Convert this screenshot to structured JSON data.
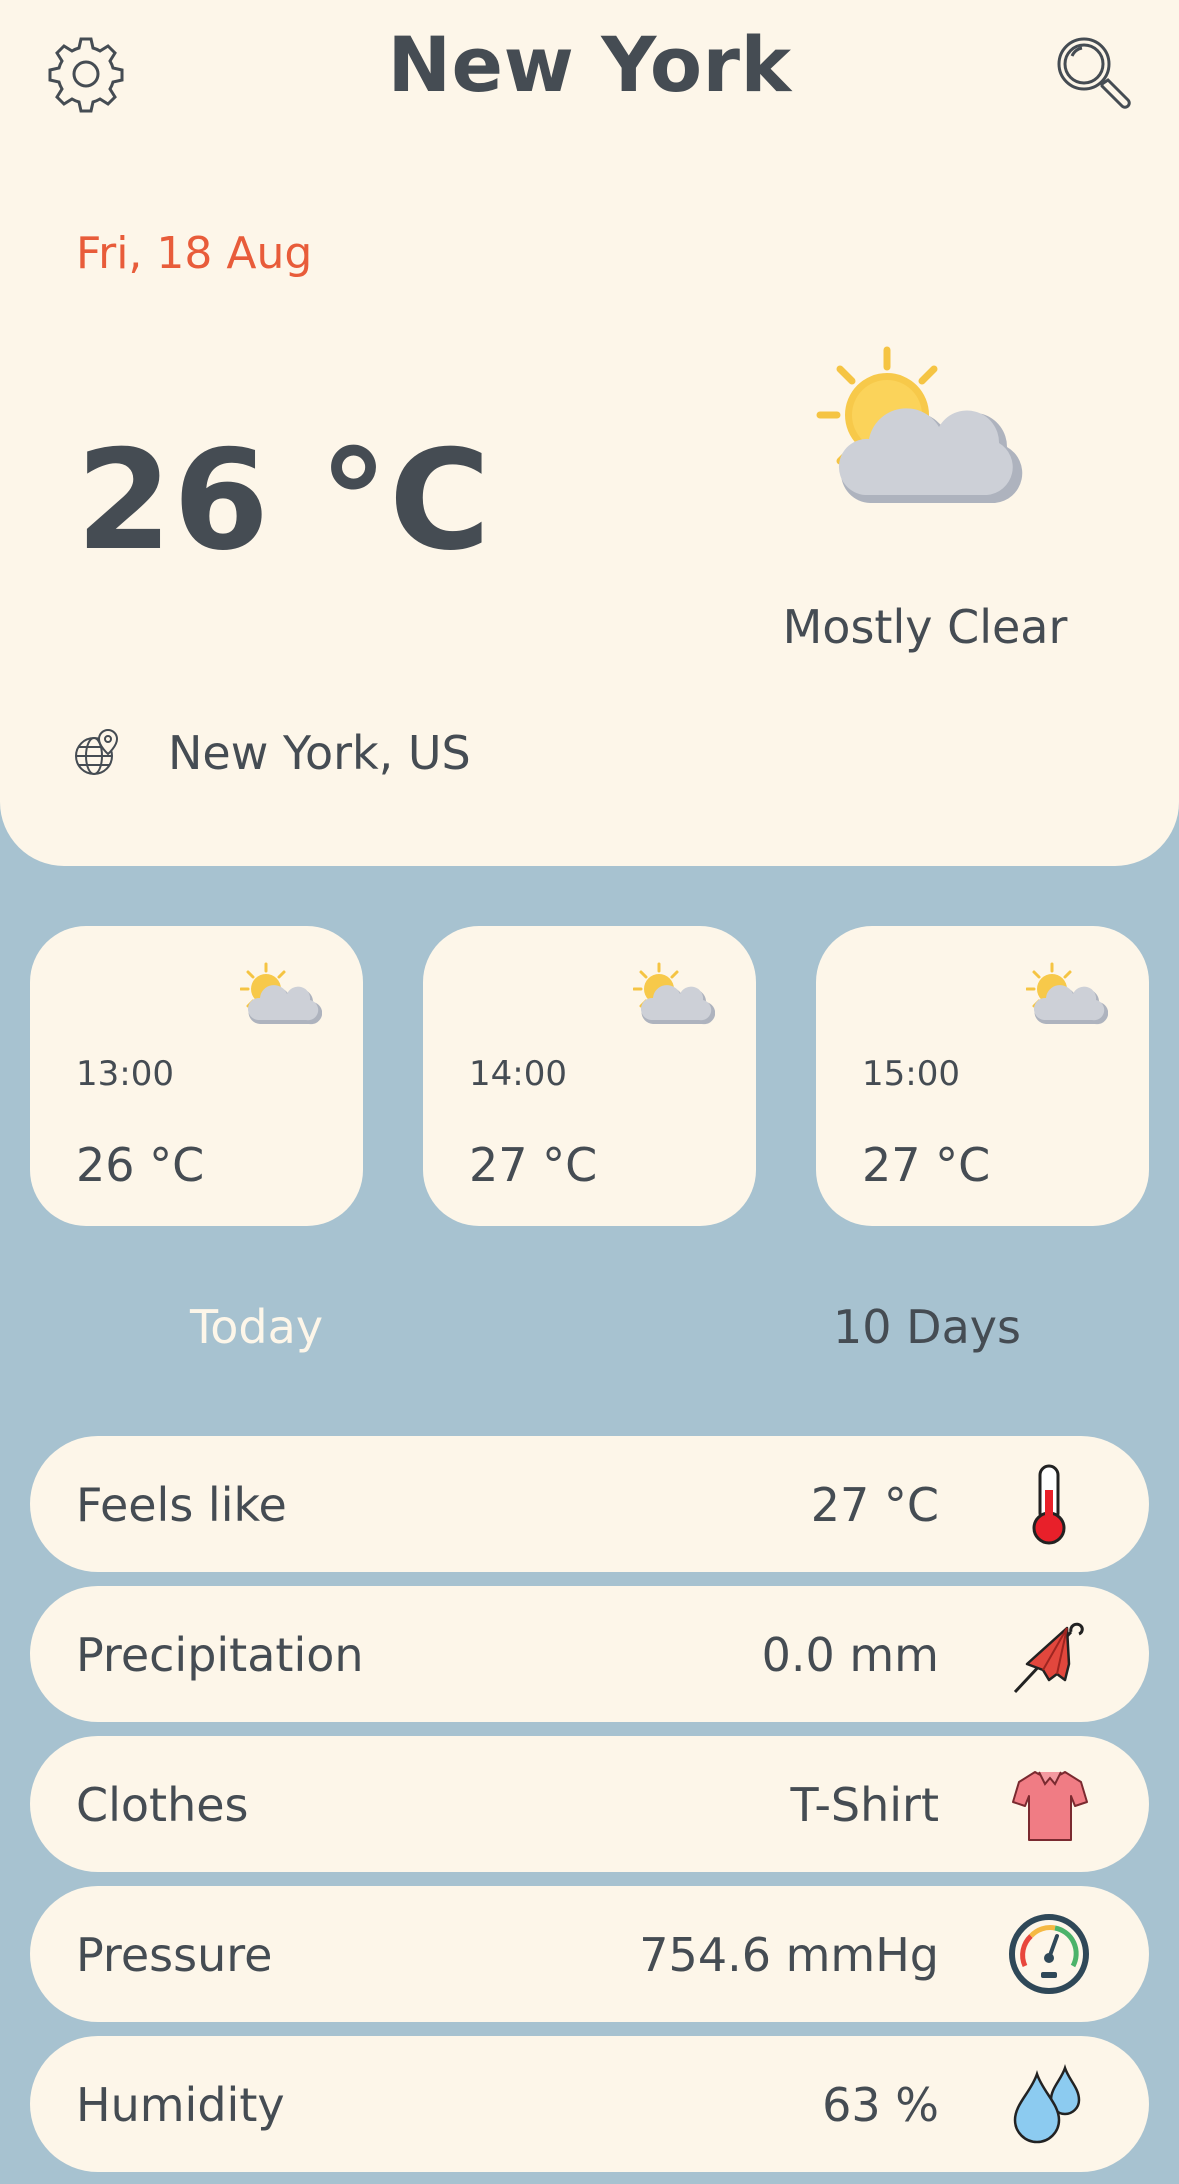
{
  "header": {
    "city": "New York",
    "settings_icon": "gear-icon",
    "search_icon": "search-icon"
  },
  "current": {
    "date": "Fri, 18 Aug",
    "temperature": "26 °C",
    "condition": "Mostly Clear",
    "condition_icon": "partly-cloudy-icon",
    "location": "New York, US",
    "location_icon": "globe-pin-icon"
  },
  "hourly": [
    {
      "time": "13:00",
      "temp": "26 °C",
      "icon": "partly-cloudy-icon"
    },
    {
      "time": "14:00",
      "temp": "27 °C",
      "icon": "partly-cloudy-icon"
    },
    {
      "time": "15:00",
      "temp": "27 °C",
      "icon": "partly-cloudy-icon"
    }
  ],
  "tabs": {
    "today": "Today",
    "ten_days": "10 Days",
    "active": "today"
  },
  "details": [
    {
      "label": "Feels like",
      "value": "27 °C",
      "icon": "thermometer-icon"
    },
    {
      "label": "Precipitation",
      "value": "0.0 mm",
      "icon": "umbrella-icon"
    },
    {
      "label": "Clothes",
      "value": "T-Shirt",
      "icon": "tshirt-icon"
    },
    {
      "label": "Pressure",
      "value": "754.6 mmHg",
      "icon": "gauge-icon"
    },
    {
      "label": "Humidity",
      "value": "63 %",
      "icon": "water-drops-icon"
    }
  ],
  "colors": {
    "background": "#A7C2D0",
    "card": "#FDF6E9",
    "text": "#454C53",
    "accent_date": "#E85C3A",
    "active_tab": "#FDF6E9"
  }
}
